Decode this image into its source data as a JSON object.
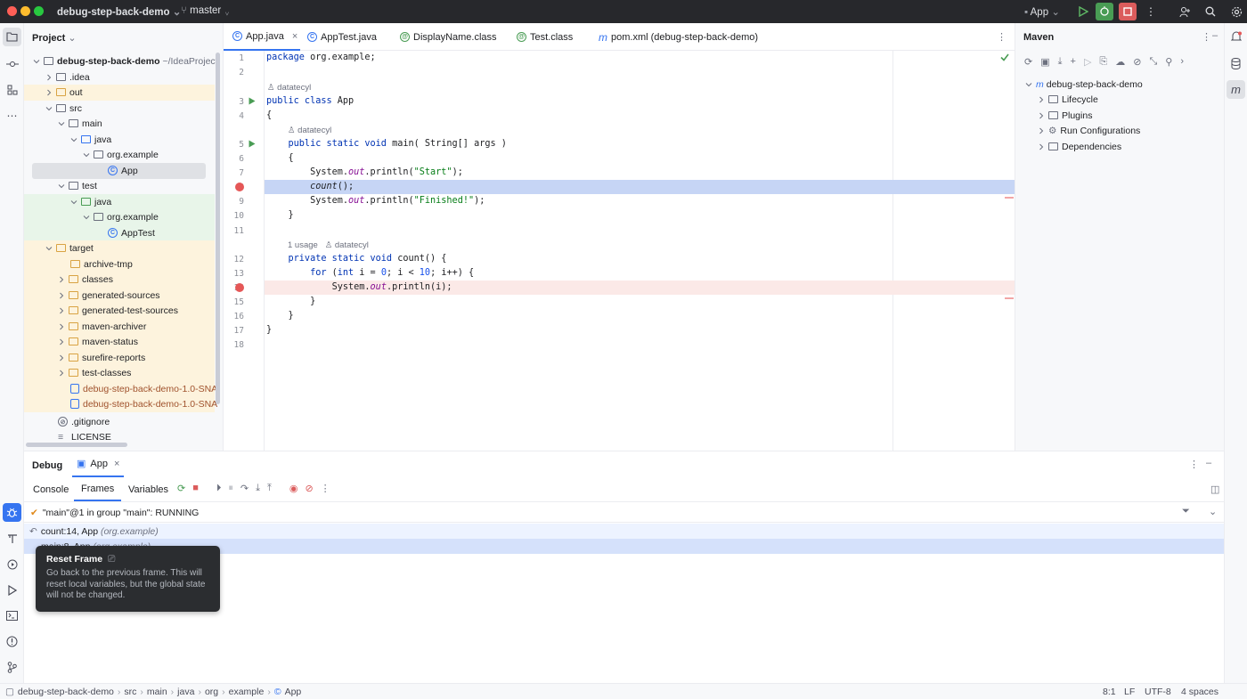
{
  "titlebar": {
    "project_name": "debug-step-back-demo",
    "branch": "master",
    "run_config": "App"
  },
  "project_panel": {
    "title": "Project",
    "rows": [
      {
        "label": "debug-step-back-demo",
        "suffix": "~/IdeaProject"
      },
      {
        "label": ".idea"
      },
      {
        "label": "out"
      },
      {
        "label": "src"
      },
      {
        "label": "main"
      },
      {
        "label": "java"
      },
      {
        "label": "org.example"
      },
      {
        "label": "App"
      },
      {
        "label": "test"
      },
      {
        "label": "java"
      },
      {
        "label": "org.example"
      },
      {
        "label": "AppTest"
      },
      {
        "label": "target"
      },
      {
        "label": "archive-tmp"
      },
      {
        "label": "classes"
      },
      {
        "label": "generated-sources"
      },
      {
        "label": "generated-test-sources"
      },
      {
        "label": "maven-archiver"
      },
      {
        "label": "maven-status"
      },
      {
        "label": "surefire-reports"
      },
      {
        "label": "test-classes"
      },
      {
        "label": "debug-step-back-demo-1.0-SNA"
      },
      {
        "label": "debug-step-back-demo-1.0-SNA"
      },
      {
        "label": ".gitignore"
      },
      {
        "label": "LICENSE"
      }
    ]
  },
  "editor": {
    "tabs": [
      {
        "label": "App.java"
      },
      {
        "label": "AppTest.java"
      },
      {
        "label": "DisplayName.class"
      },
      {
        "label": "Test.class"
      },
      {
        "label": "pom.xml (debug-step-back-demo)"
      }
    ],
    "line_numbers": [
      "1",
      "2",
      "3",
      "4",
      "5",
      "6",
      "7",
      "8",
      "9",
      "10",
      "11",
      "12",
      "13",
      "14",
      "15",
      "16",
      "17",
      "18"
    ],
    "hints": {
      "author1": "datatecyl",
      "author2": "datatecyl",
      "usage": "1 usage",
      "author3": "datatecyl"
    },
    "code": {
      "l1_kw": "package",
      "l1_rest": " org.example;",
      "l3_kw": "public class",
      "l3_rest": " App",
      "l4": "{",
      "l5_kw": "    public static void",
      "l5_rest": " main( String[] args )",
      "l6": "    {",
      "l7_a": "        System.",
      "l7_f": "out",
      "l7_b": ".println(",
      "l7_s": "\"Start\"",
      "l7_c": ");",
      "l8_a": "        ",
      "l8_i": "count",
      "l8_b": "();",
      "l9_a": "        System.",
      "l9_f": "out",
      "l9_b": ".println(",
      "l9_s": "\"Finished!\"",
      "l9_c": ");",
      "l10": "    }",
      "l12_kw": "    private static void",
      "l12_rest": " count() {",
      "l13_kw": "        for",
      "l13_a": " (",
      "l13_kw2": "int",
      "l13_b": " i = ",
      "l13_n0": "0",
      "l13_c": "; i < ",
      "l13_n10": "10",
      "l13_d": "; i++) {",
      "l14_a": "            System.",
      "l14_f": "out",
      "l14_b": ".println(i);",
      "l15": "        }",
      "l16": "    }",
      "l17": "}"
    }
  },
  "maven": {
    "title": "Maven",
    "root": "debug-step-back-demo",
    "items": [
      {
        "label": "Lifecycle"
      },
      {
        "label": "Plugins"
      },
      {
        "label": "Run Configurations"
      },
      {
        "label": "Dependencies"
      }
    ]
  },
  "debug": {
    "title": "Debug",
    "session_tab": "App",
    "subtabs": [
      "Console",
      "Frames",
      "Variables"
    ],
    "thread": "\"main\"@1 in group \"main\": RUNNING",
    "frames": [
      {
        "label": "count:14, App",
        "pkg": "(org.example)"
      },
      {
        "label": "main:8, App",
        "pkg": "(org.example)"
      }
    ]
  },
  "tooltip": {
    "title": "Reset Frame",
    "body": "Go back to the previous frame. This will reset local variables, but the global state will not be changed."
  },
  "statusbar": {
    "breadcrumb": [
      "debug-step-back-demo",
      "src",
      "main",
      "java",
      "org",
      "example",
      "App"
    ],
    "position": "8:1",
    "line_sep": "LF",
    "encoding": "UTF-8",
    "indent": "4 spaces"
  },
  "colors": {
    "accent": "#3574f0",
    "run_green": "#499c54",
    "stop_red": "#db5c5c",
    "current_line": "#c6d5f5",
    "breakpoint_line": "#fbe9e7"
  }
}
